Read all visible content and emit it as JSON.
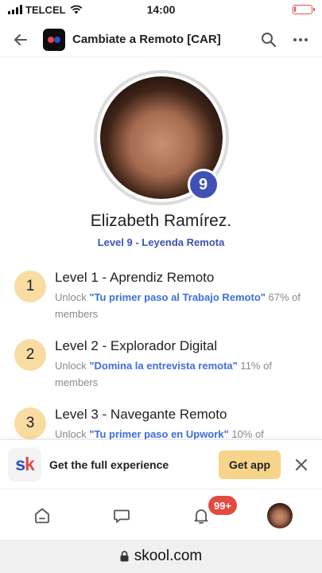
{
  "status_bar": {
    "carrier": "TELCEL",
    "time": "14:00",
    "signal_bars": 4,
    "battery_level": 0.08
  },
  "header": {
    "group_name": "Cambiate a Remoto [CAR]",
    "icons": [
      "back-arrow-icon",
      "search-icon",
      "more-icon"
    ]
  },
  "profile": {
    "name": "Elizabeth Ramírez.",
    "level_number": "9",
    "level_label": "Level 9 - Leyenda Remota"
  },
  "levels": [
    {
      "number": "1",
      "title": "Level 1 - Aprendiz Remoto",
      "unlock_prefix": "Unlock ",
      "course": "\"Tu primer paso al Trabajo Remoto\"",
      "members_text": " 67% of members"
    },
    {
      "number": "2",
      "title": "Level 2 - Explorador Digital",
      "unlock_prefix": "Unlock ",
      "course": "\"Domina la entrevista remota\"",
      "members_text": " 11% of members"
    },
    {
      "number": "3",
      "title": "Level 3 - Navegante Remoto",
      "unlock_prefix": "Unlock ",
      "course": "\"Tu primer paso en Upwork\"",
      "members_text": " 10% of"
    }
  ],
  "app_banner": {
    "text": "Get the full experience",
    "button_label": "Get app",
    "logo_s": "s",
    "logo_k": "k"
  },
  "bottom_nav": {
    "notification_count": "99+"
  },
  "browser": {
    "url": "skool.com"
  },
  "colors": {
    "accent_blue": "#3e51b5",
    "link_blue": "#3e6ee0",
    "level_circle": "#f8dca1",
    "get_app_button": "#f8d48a",
    "notification_red": "#e34b3f"
  }
}
